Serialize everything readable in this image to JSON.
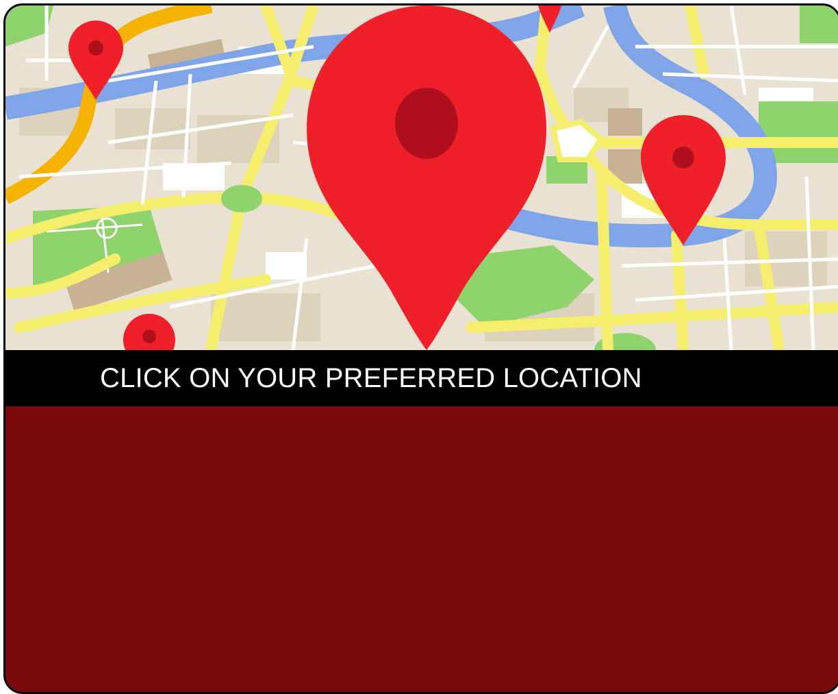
{
  "prompt": {
    "text": "CLICK ON YOUR PREFERRED LOCATION"
  },
  "map": {
    "icon": "location-pin-icon",
    "pin_color": "#f0202b",
    "pin_center_color": "#b0101d"
  },
  "colors": {
    "banner_background": "#000000",
    "banner_text": "#ffffff",
    "panel_background": "#7b0a0c"
  }
}
